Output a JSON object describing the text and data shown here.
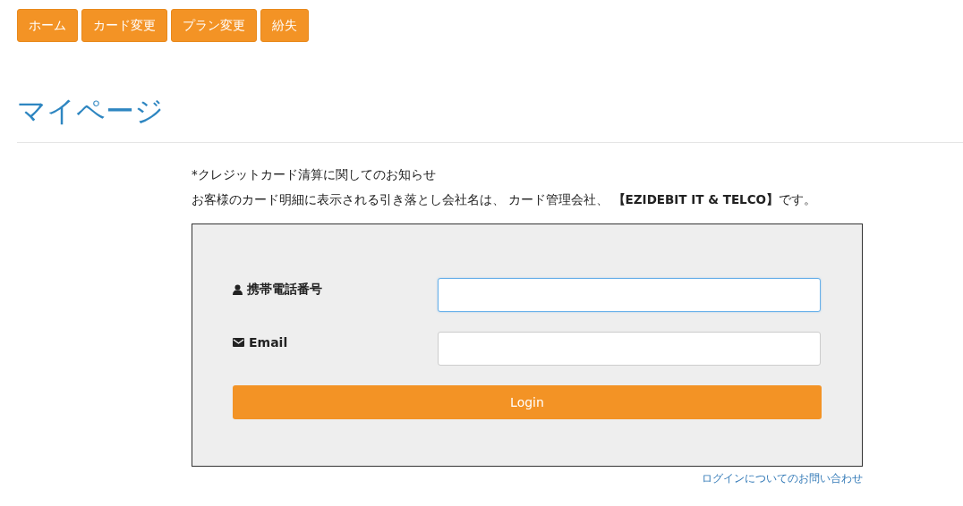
{
  "nav": [
    {
      "label": "ホーム"
    },
    {
      "label": "カード変更"
    },
    {
      "label": "プラン変更"
    },
    {
      "label": "紛失"
    }
  ],
  "page_title": "マイページ",
  "notice": [
    "*クレジットカード清算に関してのお知らせ",
    "お客様のカード明細に表示される引き落とし会社名は、 カード管理会社、 **【EZIDEBIT IT & TELCO】**です。"
  ],
  "form": {
    "fields": [
      {
        "kind": "phone",
        "label": "携帯電話番号",
        "focused": true
      },
      {
        "kind": "email",
        "label": "Email",
        "focused": false
      }
    ],
    "submit": "Login"
  },
  "help_link": "ログインについてのお問い合わせ"
}
